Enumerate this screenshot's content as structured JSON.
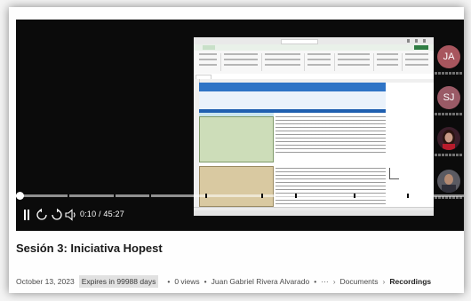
{
  "video": {
    "current_time": "0:10",
    "duration": "45:27",
    "time_display": "0:10 / 45:27",
    "progress_fraction": 0.002
  },
  "participants": [
    {
      "initials": "JA",
      "color": "#a8565e"
    },
    {
      "initials": "SJ",
      "color": "#9a5a66"
    },
    {
      "initials": "",
      "photo": true
    },
    {
      "initials": "",
      "photo": true
    }
  ],
  "recording": {
    "title": "Sesión 3: Iniciativa Hopest",
    "date": "October 13, 2023",
    "expires_badge": "Expires in 99988 days",
    "views": "0 views",
    "owner": "Juan Gabriel Rivera Alvarado",
    "breadcrumb": [
      "···",
      "Documents",
      "Recordings"
    ]
  },
  "icons": {
    "captions": "captions-icon",
    "rewind": "rewind-10-icon",
    "forward": "forward-10-icon",
    "volume": "volume-icon"
  }
}
